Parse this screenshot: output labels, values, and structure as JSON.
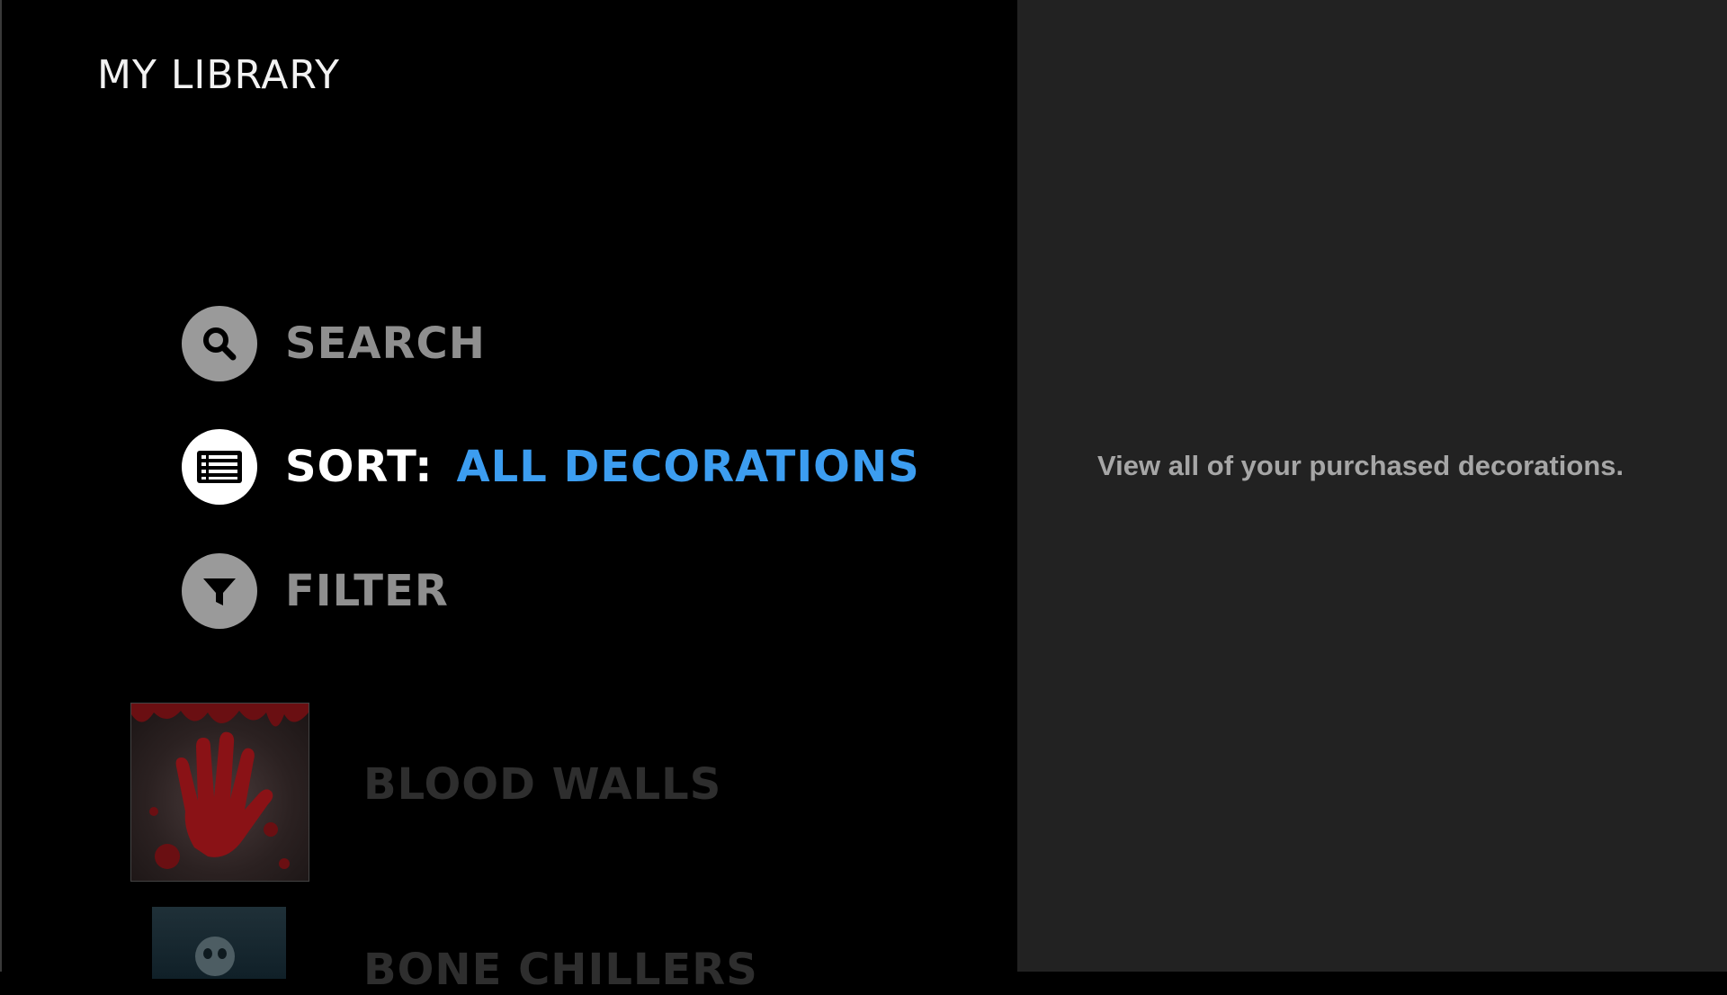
{
  "header": {
    "title": "MY LIBRARY"
  },
  "menu": {
    "search_label": "SEARCH",
    "sort_label": "SORT:",
    "sort_value": "ALL DECORATIONS",
    "filter_label": "FILTER"
  },
  "items": [
    {
      "title": "BLOOD WALLS",
      "icon": "bloody-handprint"
    },
    {
      "title": "BONE CHILLERS",
      "icon": "skeleton"
    }
  ],
  "detail": {
    "description": "View all of your purchased decorations."
  },
  "colors": {
    "accent": "#3c9df0",
    "background": "#000000",
    "panel": "#222222"
  },
  "icons": {
    "search": "search-icon",
    "sort": "list-icon",
    "filter": "filter-icon"
  }
}
